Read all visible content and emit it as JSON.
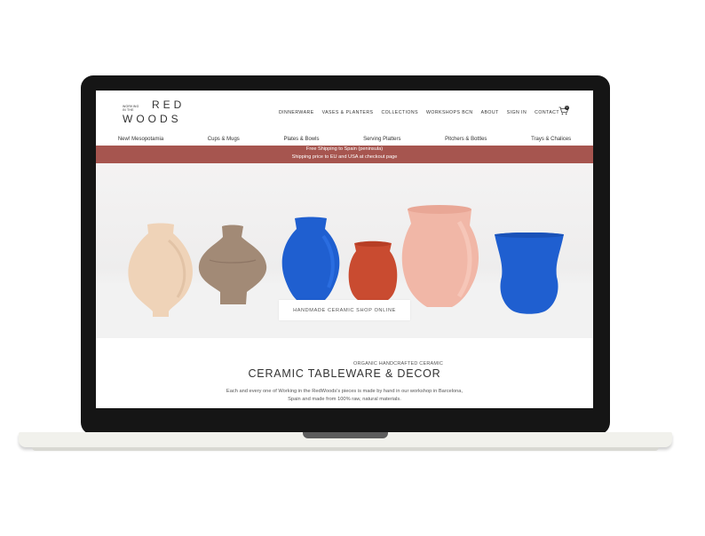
{
  "logo": {
    "small_lines": [
      "WORKING",
      "IN THE"
    ],
    "red": "RED",
    "woods": "WOODS"
  },
  "nav": {
    "main": [
      "DINNERWARE",
      "VASES & PLANTERS",
      "COLLECTIONS",
      "WORKSHOPS BCN",
      "ABOUT",
      "SIGN IN",
      "CONTACT"
    ],
    "cart_count": "0",
    "categories": [
      "New! Mesopotamia",
      "Cups & Mugs",
      "Plates & Bowls",
      "Serving Platters",
      "Pitchers & Bottles",
      "Trays & Chalices"
    ]
  },
  "banner": {
    "line1": "Free Shipping to Spain (peninsula)",
    "line2": "Shipping price to EU and USA at checkout page"
  },
  "hero": {
    "button_label": "HANDMADE CERAMIC SHOP ONLINE"
  },
  "intro": {
    "eyebrow": "ORGANIC HANDCRAFTED CERAMIC",
    "title": "CERAMIC TABLEWARE & DECOR",
    "desc_line1": "Each and every one of Working in the RedWoods's pieces is made by hand in our workshop in Barcelona,",
    "desc_line2": "Spain and made from 100% raw, natural materials."
  },
  "colors": {
    "banner": "#a6554f",
    "vase_cream": "#efd3b8",
    "vase_brown": "#a28a76",
    "vase_blue": "#1f5fd0",
    "vase_red": "#c94b30",
    "vase_pink": "#f1b7a7",
    "laptop_bezel": "#151515"
  }
}
